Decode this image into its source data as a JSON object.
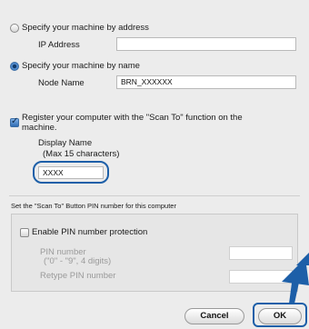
{
  "address_option": {
    "label": "Specify your machine by address",
    "selected": false
  },
  "ip_address": {
    "label": "IP Address",
    "value": ""
  },
  "name_option": {
    "label": "Specify your machine by name",
    "selected": true
  },
  "node_name": {
    "label": "Node Name",
    "value": "BRN_XXXXXX"
  },
  "register": {
    "label_line1": "Register your computer with the \"Scan To\" function on the",
    "label_line2": "machine.",
    "checked": true
  },
  "display_name": {
    "label": "Display Name",
    "hint": "(Max 15 characters)",
    "value": "XXXX"
  },
  "pin_section": {
    "heading": "Set the \"Scan To\" Button PIN number for this computer",
    "enable_label": "Enable PIN number protection",
    "enabled": false,
    "pin_label": "PIN number",
    "pin_hint": "(\"0\" - \"9\",  4 digits)",
    "pin_value": "",
    "retype_label": "Retype PIN number",
    "retype_value": ""
  },
  "buttons": {
    "cancel": "Cancel",
    "ok": "OK"
  },
  "colors": {
    "accent": "#1d5fa8",
    "background": "#ececec"
  }
}
